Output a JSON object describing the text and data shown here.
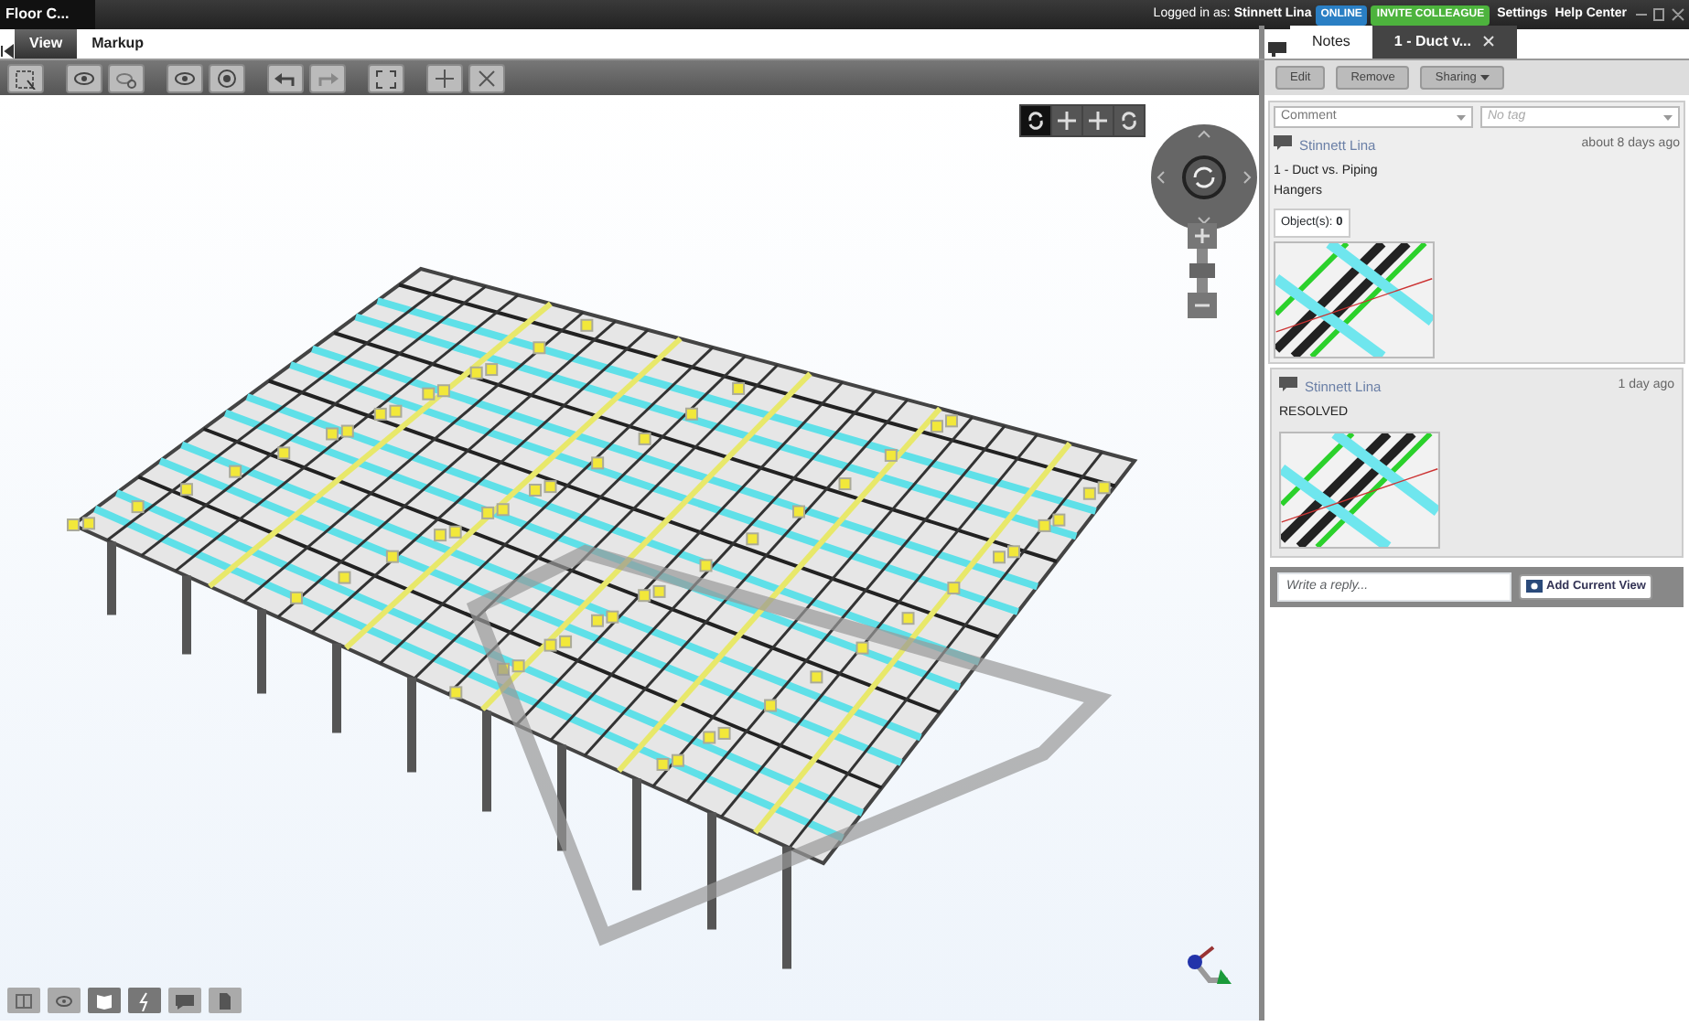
{
  "window": {
    "title": "Floor C..."
  },
  "header": {
    "login_label": "Logged in as:",
    "user": "Stinnett Lina",
    "status_badge": "ONLINE",
    "invite_button": "INVITE COLLEAGUE",
    "links": [
      "Settings",
      "Help Center"
    ]
  },
  "tabs": [
    {
      "label": "View",
      "selected": true
    },
    {
      "label": "Markup",
      "selected": false
    }
  ],
  "panel_tabs": [
    {
      "label": "Notes",
      "selected": false,
      "closable": false
    },
    {
      "label": "1 - Duct v...",
      "selected": true,
      "closable": true
    }
  ],
  "note_actions": [
    {
      "label": "Edit",
      "dropdown": false
    },
    {
      "label": "Remove",
      "dropdown": false
    },
    {
      "label": "Sharing",
      "dropdown": true
    }
  ],
  "filters": {
    "type": "Comment",
    "tag_placeholder": "No tag"
  },
  "notes": [
    {
      "author": "Stinnett Lina",
      "time": "about 8 days ago",
      "text": "1 - Duct vs. Piping Hangers",
      "objects_label": "Object(s):",
      "objects_count": "0"
    },
    {
      "author": "Stinnett Lina",
      "time": "1 day ago",
      "text": "RESOLVED"
    }
  ],
  "zoom": {
    "level": 0.5
  },
  "reply": {
    "placeholder": "Write a reply...",
    "button": "Add Current View"
  }
}
